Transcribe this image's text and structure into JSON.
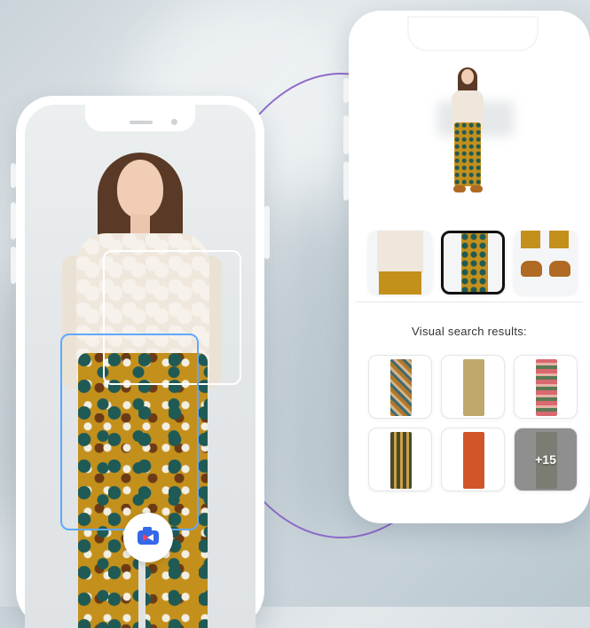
{
  "results": {
    "title": "Visual search results:",
    "more_count": "+15",
    "items": [
      {
        "icon": "pants-result-image"
      },
      {
        "icon": "pants-result-image"
      },
      {
        "icon": "pants-result-image"
      },
      {
        "icon": "pants-result-image"
      },
      {
        "icon": "pants-result-image"
      },
      {
        "icon": "pants-result-image"
      }
    ]
  },
  "capture": {
    "button_icon": "camera-icon",
    "brand_colors": {
      "blue": "#3568e8",
      "red": "#ff3d5a"
    }
  },
  "selection_colors": {
    "active": "#5fa8ff",
    "inactive": "#ffffff"
  },
  "accent_arc_color": "#8e6cc9"
}
